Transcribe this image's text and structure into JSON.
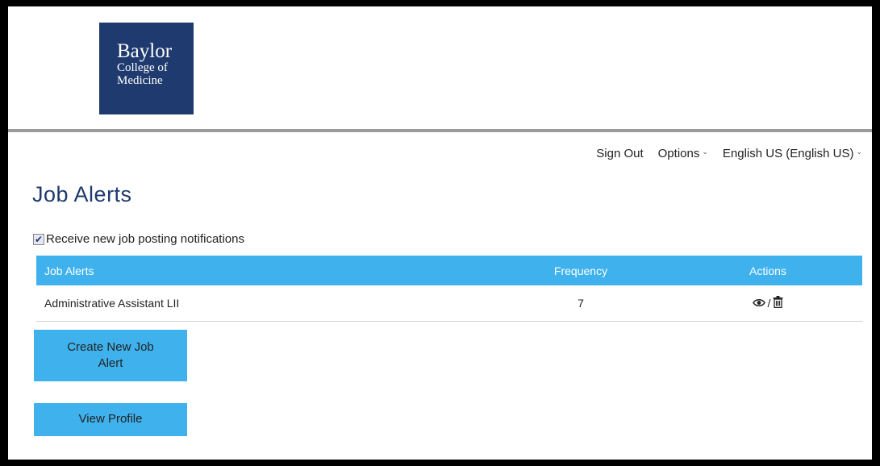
{
  "logo": {
    "line1": "Baylor",
    "line2": "College of",
    "line3": "Medicine"
  },
  "nav": {
    "sign_out": "Sign Out",
    "options": "Options",
    "language": "English US (English US)"
  },
  "page": {
    "title": "Job Alerts"
  },
  "notify": {
    "label": "Receive new job posting notifications",
    "checked": true
  },
  "table": {
    "headers": [
      "Job Alerts",
      "Frequency",
      "Actions"
    ],
    "rows": [
      {
        "name": "Administrative Assistant LII",
        "frequency": "7",
        "sep": "/"
      }
    ]
  },
  "buttons": {
    "create": "Create New Job Alert",
    "profile": "View Profile"
  },
  "colors": {
    "brand": "#1f3a6e",
    "accent": "#3fb2ee"
  }
}
